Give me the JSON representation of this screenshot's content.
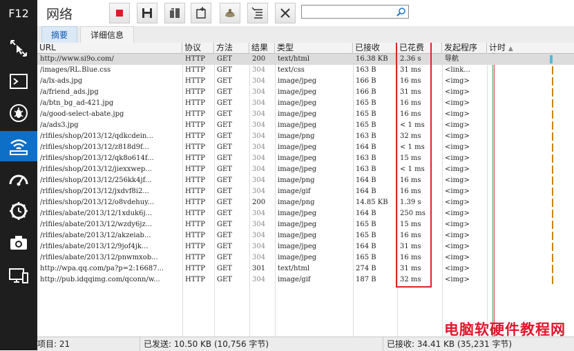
{
  "devtools": {
    "f12_label": "F12"
  },
  "header": {
    "title": "网络",
    "search_placeholder": ""
  },
  "tabs": [
    {
      "label": "摘要"
    },
    {
      "label": "详细信息"
    }
  ],
  "columns": [
    {
      "label": "URL"
    },
    {
      "label": "协议"
    },
    {
      "label": "方法"
    },
    {
      "label": "结果"
    },
    {
      "label": "类型"
    },
    {
      "label": "已接收"
    },
    {
      "label": "已花费"
    },
    {
      "label": "发起程序"
    },
    {
      "label": "计时"
    }
  ],
  "sort_indicator": "▲",
  "rows": [
    {
      "url": "http://www.si9o.com/",
      "protocol": "HTTP",
      "method": "GET",
      "result": "200",
      "type": "text/html",
      "received": "16.38 KB",
      "taken": "2.36 s",
      "initiator": "导航"
    },
    {
      "url": "/images/RL.Blue.css",
      "protocol": "HTTP",
      "method": "GET",
      "result": "304",
      "type": "text/css",
      "received": "163 B",
      "taken": "31 ms",
      "initiator": "<link..."
    },
    {
      "url": "/a/lx-ads.jpg",
      "protocol": "HTTP",
      "method": "GET",
      "result": "304",
      "type": "image/jpeg",
      "received": "166 B",
      "taken": "16 ms",
      "initiator": "<img>"
    },
    {
      "url": "/a/friend_ads.jpg",
      "protocol": "HTTP",
      "method": "GET",
      "result": "304",
      "type": "image/jpeg",
      "received": "166 B",
      "taken": "31 ms",
      "initiator": "<img>"
    },
    {
      "url": "/a/btn_bg_ad-421.jpg",
      "protocol": "HTTP",
      "method": "GET",
      "result": "304",
      "type": "image/jpeg",
      "received": "165 B",
      "taken": "16 ms",
      "initiator": "<img>"
    },
    {
      "url": "/a/good-select-abate.jpg",
      "protocol": "HTTP",
      "method": "GET",
      "result": "304",
      "type": "image/jpeg",
      "received": "165 B",
      "taken": "16 ms",
      "initiator": "<img>"
    },
    {
      "url": "/a/ads3.jpg",
      "protocol": "HTTP",
      "method": "GET",
      "result": "304",
      "type": "image/jpeg",
      "received": "165 B",
      "taken": "< 1 ms",
      "initiator": "<img>"
    },
    {
      "url": "/rlfiles/shop/2013/12/qdkcdein...",
      "protocol": "HTTP",
      "method": "GET",
      "result": "304",
      "type": "image/png",
      "received": "163 B",
      "taken": "32 ms",
      "initiator": "<img>"
    },
    {
      "url": "/rlfiles/shop/2013/12/z818d9f...",
      "protocol": "HTTP",
      "method": "GET",
      "result": "304",
      "type": "image/jpeg",
      "received": "164 B",
      "taken": "< 1 ms",
      "initiator": "<img>"
    },
    {
      "url": "/rlfiles/shop/2013/12/qk8o614f...",
      "protocol": "HTTP",
      "method": "GET",
      "result": "304",
      "type": "image/jpeg",
      "received": "163 B",
      "taken": "15 ms",
      "initiator": "<img>"
    },
    {
      "url": "/rlfiles/shop/2013/12/jiexxwep...",
      "protocol": "HTTP",
      "method": "GET",
      "result": "304",
      "type": "image/jpeg",
      "received": "163 B",
      "taken": "< 1 ms",
      "initiator": "<img>"
    },
    {
      "url": "/rlfiles/shop/2013/12/256kk4jf...",
      "protocol": "HTTP",
      "method": "GET",
      "result": "304",
      "type": "image/png",
      "received": "164 B",
      "taken": "16 ms",
      "initiator": "<img>"
    },
    {
      "url": "/rlfiles/shop/2013/12/jxdvf8i2...",
      "protocol": "HTTP",
      "method": "GET",
      "result": "304",
      "type": "image/gif",
      "received": "164 B",
      "taken": "16 ms",
      "initiator": "<img>"
    },
    {
      "url": "/rlfiles/shop/2013/12/o8vdehuy...",
      "protocol": "HTTP",
      "method": "GET",
      "result": "200",
      "type": "image/png",
      "received": "14.85 KB",
      "taken": "1.39 s",
      "initiator": "<img>"
    },
    {
      "url": "/rlfiles/abate/2013/12/1xduk6j...",
      "protocol": "HTTP",
      "method": "GET",
      "result": "304",
      "type": "image/jpeg",
      "received": "164 B",
      "taken": "250 ms",
      "initiator": "<img>"
    },
    {
      "url": "/rlfiles/abate/2013/12/wzdy6jz...",
      "protocol": "HTTP",
      "method": "GET",
      "result": "304",
      "type": "image/jpeg",
      "received": "165 B",
      "taken": "15 ms",
      "initiator": "<img>"
    },
    {
      "url": "/rlfiles/abate/2013/12/akzeiab...",
      "protocol": "HTTP",
      "method": "GET",
      "result": "304",
      "type": "image/jpeg",
      "received": "165 B",
      "taken": "16 ms",
      "initiator": "<img>"
    },
    {
      "url": "/rlfiles/abate/2013/12/9jof4jk...",
      "protocol": "HTTP",
      "method": "GET",
      "result": "304",
      "type": "image/jpeg",
      "received": "164 B",
      "taken": "31 ms",
      "initiator": "<img>"
    },
    {
      "url": "/rlfiles/abate/2013/12/pnwmxob...",
      "protocol": "HTTP",
      "method": "GET",
      "result": "304",
      "type": "image/jpeg",
      "received": "165 B",
      "taken": "16 ms",
      "initiator": "<img>"
    },
    {
      "url": "http://wpa.qq.com/pa?p=2:16687...",
      "protocol": "HTTP",
      "method": "GET",
      "result": "301",
      "type": "text/html",
      "received": "274 B",
      "taken": "31 ms",
      "initiator": "<img>"
    },
    {
      "url": "http://pub.idqqimg.com/qconn/w...",
      "protocol": "HTTP",
      "method": "GET",
      "result": "304",
      "type": "image/gif",
      "received": "187 B",
      "taken": "32 ms",
      "initiator": "<img>"
    }
  ],
  "status": {
    "items": "项目: 21",
    "sent": "已发送: 10.50 KB (10,756 字节)",
    "received": "已接收: 34.41 KB (35,231 字节)"
  },
  "watermark": "电脑软硬件教程网",
  "colors": {
    "accent": "#0e6fc7",
    "highlight_box": "#dd2222",
    "watermark": "#e0152a"
  }
}
